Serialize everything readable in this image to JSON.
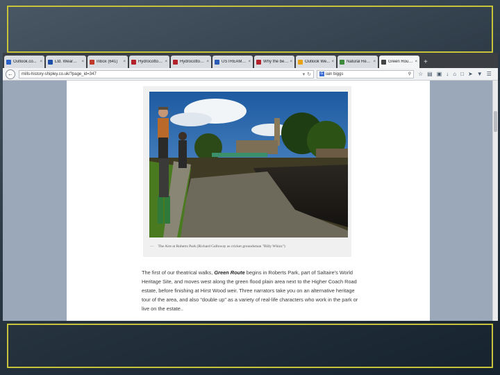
{
  "browser": {
    "tabs": [
      {
        "label": "Outlook.co...",
        "color": "#2a62c9"
      },
      {
        "label": "Ltd. Wearma...",
        "color": "#1d4fa8"
      },
      {
        "label": "Inbox (641)",
        "color": "#c0392b"
      },
      {
        "label": "Hydrocotton...",
        "color": "#b3212b"
      },
      {
        "label": "Hydrocotton...",
        "color": "#b3212b"
      },
      {
        "label": "USTREAM: ...",
        "color": "#2a5bb5"
      },
      {
        "label": "Why the bea...",
        "color": "#b3212b"
      },
      {
        "label": "Outlook We...",
        "color": "#e8a317"
      },
      {
        "label": "Natural Rese...",
        "color": "#3c8b3c"
      },
      {
        "label": "Green Route |...",
        "color": "#444",
        "active": true
      }
    ],
    "new_tab": "+",
    "url": "mills-history-shipley.co.uk/?page_id=347",
    "search_engine_letter": "G",
    "search_query": "iain biggs"
  },
  "figure": {
    "caption": "The Aire at Roberts Park (Richard Galloway as cricket groundsman \"Billy Whizz\")"
  },
  "article": {
    "text_before": "The first of our theatrical walks, ",
    "title": "Green Route",
    "text_after": " begins in Roberts Park, part of Saltaire's World Heritage Site, and moves west along the green flood plain area next to the Higher Coach Road estate, before finishing at Hirst Wood weir. Three narrators take you on an alternative heritage tour of the area, and also \"double up\" as a variety of real-life characters who work in the park or live on the estate.."
  },
  "icons": [
    "back-arrow-icon",
    "refresh-icon",
    "bookmark-star-icon",
    "home-icon",
    "download-icon",
    "menu-icon"
  ]
}
